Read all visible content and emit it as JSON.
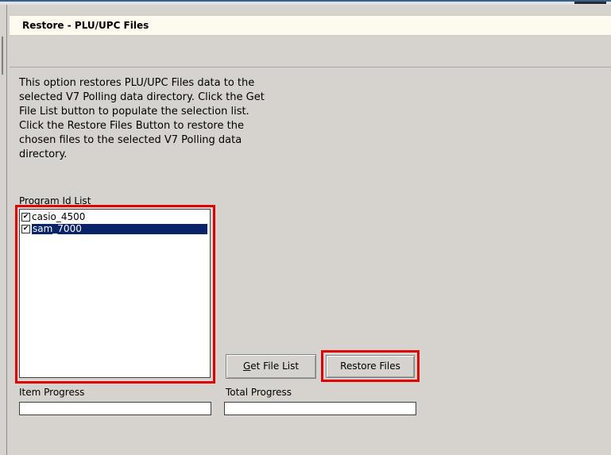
{
  "window": {
    "title": "Restore - PLU/UPC Files"
  },
  "description": "This option restores PLU/UPC Files data to the\nselected V7 Polling data directory. Click the Get\nFile List button to populate the selection list.\nClick the Restore Files Button to restore the\nchosen files to the selected V7 Polling data\ndirectory.",
  "program_list": {
    "label": "Program Id List",
    "items": [
      {
        "label": "casio_4500",
        "checked": true,
        "selected": false
      },
      {
        "label": "sam_7000",
        "checked": true,
        "selected": true
      }
    ]
  },
  "buttons": {
    "get_file_list_prefix": "",
    "get_file_list_accel": "G",
    "get_file_list_rest": "et File List",
    "restore_files": "Restore Files"
  },
  "progress": {
    "item_label": "Item Progress",
    "item_value": 0,
    "total_label": "Total Progress",
    "total_value": 0
  },
  "colors": {
    "highlight": "#e00000",
    "selection": "#0a246a",
    "panel": "#d6d3ce"
  }
}
